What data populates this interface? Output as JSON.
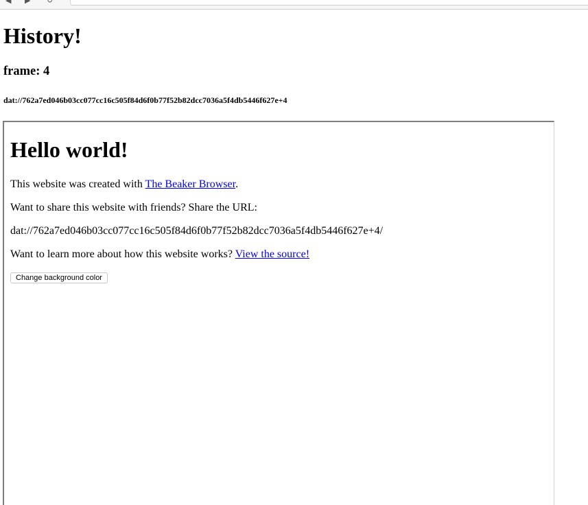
{
  "browser": {
    "url": ""
  },
  "page": {
    "title": "History!",
    "frame_label": "frame: 4",
    "dat_url": "dat://762a7ed046b03cc077cc16c505f84d6f0b77f52b82dcc7036a5f4db5446f627e+4"
  },
  "frame_content": {
    "heading": "Hello world!",
    "created_prefix": "This website was created with ",
    "beaker_link": "The Beaker Browser",
    "created_suffix": ".",
    "share_text": "Want to share this website with friends? Share the URL:",
    "share_url": "dat://762a7ed046b03cc077cc16c505f84d6f0b77f52b82dcc7036a5f4db5446f627e+4/",
    "learn_prefix": "Want to learn more about how this website works? ",
    "source_link": "View the source!",
    "button_label": "Change background color"
  }
}
